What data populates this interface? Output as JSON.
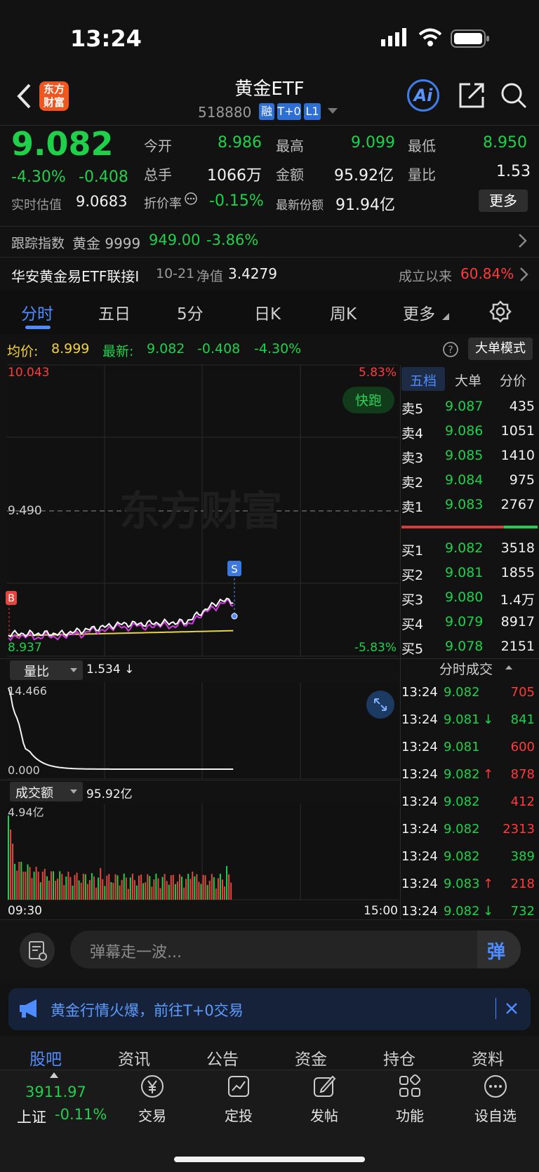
{
  "status": {
    "time": "13:24"
  },
  "header": {
    "logo_text": "东方财富",
    "title": "黄金ETF",
    "code": "518880",
    "badges": [
      "融",
      "T+0",
      "L1"
    ],
    "ai_label": "Ai"
  },
  "quote": {
    "price": "9.082",
    "change_pct": "-4.30%",
    "change": "-0.408",
    "est_label": "实时估值",
    "est_value": "9.0683",
    "open_label": "今开",
    "open_value": "8.986",
    "high_label": "最高",
    "high_value": "9.099",
    "low_label": "最低",
    "low_value": "8.950",
    "vol_label": "总手",
    "vol_value": "1066万",
    "amt_label": "金额",
    "amt_value": "95.92亿",
    "ratio_label": "量比",
    "ratio_value": "1.53",
    "disc_label": "折价率",
    "disc_value": "-0.15%",
    "shares_label": "最新份额",
    "shares_value": "91.94亿",
    "more_label": "更多"
  },
  "tracking": {
    "label": "跟踪指数",
    "name": "黄金 9999",
    "value": "949.00",
    "pct": "-3.86%"
  },
  "linked": {
    "name": "华安黄金易ETF联接I",
    "date": "10-21",
    "nav_label": "净值",
    "nav": "3.4279",
    "since_label": "成立以来",
    "since_pct": "60.84%"
  },
  "tabs": [
    "分时",
    "五日",
    "5分",
    "日K",
    "周K",
    "更多"
  ],
  "summary": {
    "avg_label": "均价:",
    "avg": "8.999",
    "latest_label": "最新:",
    "latest": "9.082",
    "chg": "-0.408",
    "pct": "-4.30%",
    "mode_button": "大单模式"
  },
  "chart": {
    "top_price": "10.043",
    "top_pct": "5.83%",
    "mid_price": "9.490",
    "bottom_price": "8.937",
    "bottom_pct": "-5.83%",
    "watermark": "东方财富",
    "fast_run": "快跑",
    "marker_b": "B",
    "marker_s": "S",
    "ratio_label": "量比",
    "ratio_value": "1.534 ↓",
    "ratio_top": "14.466",
    "ratio_bottom": "0.000",
    "amount_label": "成交额",
    "amount_value": "95.92亿",
    "amount_top": "4.94亿",
    "time_start": "09:30",
    "time_end": "15:00",
    "colors": {
      "price_line": "#ffffff",
      "avg_line": "#e6d34a",
      "ma_line": "#d43be0"
    }
  },
  "orderbook": {
    "tabs": [
      "五档",
      "大单",
      "分价"
    ],
    "asks": [
      {
        "label": "卖5",
        "price": "9.087",
        "vol": "435"
      },
      {
        "label": "卖4",
        "price": "9.086",
        "vol": "1051"
      },
      {
        "label": "卖3",
        "price": "9.085",
        "vol": "1410"
      },
      {
        "label": "卖2",
        "price": "9.084",
        "vol": "975"
      },
      {
        "label": "卖1",
        "price": "9.083",
        "vol": "2767"
      }
    ],
    "bids": [
      {
        "label": "买1",
        "price": "9.082",
        "vol": "3518"
      },
      {
        "label": "买2",
        "price": "9.081",
        "vol": "1855"
      },
      {
        "label": "买3",
        "price": "9.080",
        "vol": "1.4万"
      },
      {
        "label": "买4",
        "price": "9.079",
        "vol": "8917"
      },
      {
        "label": "买5",
        "price": "9.078",
        "vol": "2151"
      }
    ],
    "trades_title": "分时成交",
    "trades": [
      {
        "time": "13:24",
        "price": "9.082",
        "arrow": "",
        "vol": "705",
        "vcolor": "red"
      },
      {
        "time": "13:24",
        "price": "9.081",
        "arrow": "↓",
        "vol": "841",
        "vcolor": "green"
      },
      {
        "time": "13:24",
        "price": "9.081",
        "arrow": "",
        "vol": "600",
        "vcolor": "red"
      },
      {
        "time": "13:24",
        "price": "9.082",
        "arrow": "↑",
        "vol": "878",
        "vcolor": "red"
      },
      {
        "time": "13:24",
        "price": "9.082",
        "arrow": "",
        "vol": "412",
        "vcolor": "red"
      },
      {
        "time": "13:24",
        "price": "9.082",
        "arrow": "",
        "vol": "2313",
        "vcolor": "red"
      },
      {
        "time": "13:24",
        "price": "9.082",
        "arrow": "",
        "vol": "389",
        "vcolor": "green"
      },
      {
        "time": "13:24",
        "price": "9.083",
        "arrow": "↑",
        "vol": "218",
        "vcolor": "red"
      },
      {
        "time": "13:24",
        "price": "9.082",
        "arrow": "↓",
        "vol": "732",
        "vcolor": "green"
      }
    ]
  },
  "comment": {
    "placeholder": "弹幕走一波...",
    "send_label": "弹"
  },
  "banner": {
    "text": "黄金行情火爆，前往T+0交易"
  },
  "bottom_tabs": [
    "股吧",
    "资讯",
    "公告",
    "资金",
    "持仓",
    "资料"
  ],
  "index": {
    "value": "3911.97",
    "name": "上证",
    "pct": "-0.11%"
  },
  "dock": [
    {
      "label": "交易",
      "icon": "yen-icon"
    },
    {
      "label": "定投",
      "icon": "chart-icon"
    },
    {
      "label": "发帖",
      "icon": "edit-icon"
    },
    {
      "label": "功能",
      "icon": "grid-icon"
    },
    {
      "label": "设自选",
      "icon": "more-icon"
    }
  ]
}
